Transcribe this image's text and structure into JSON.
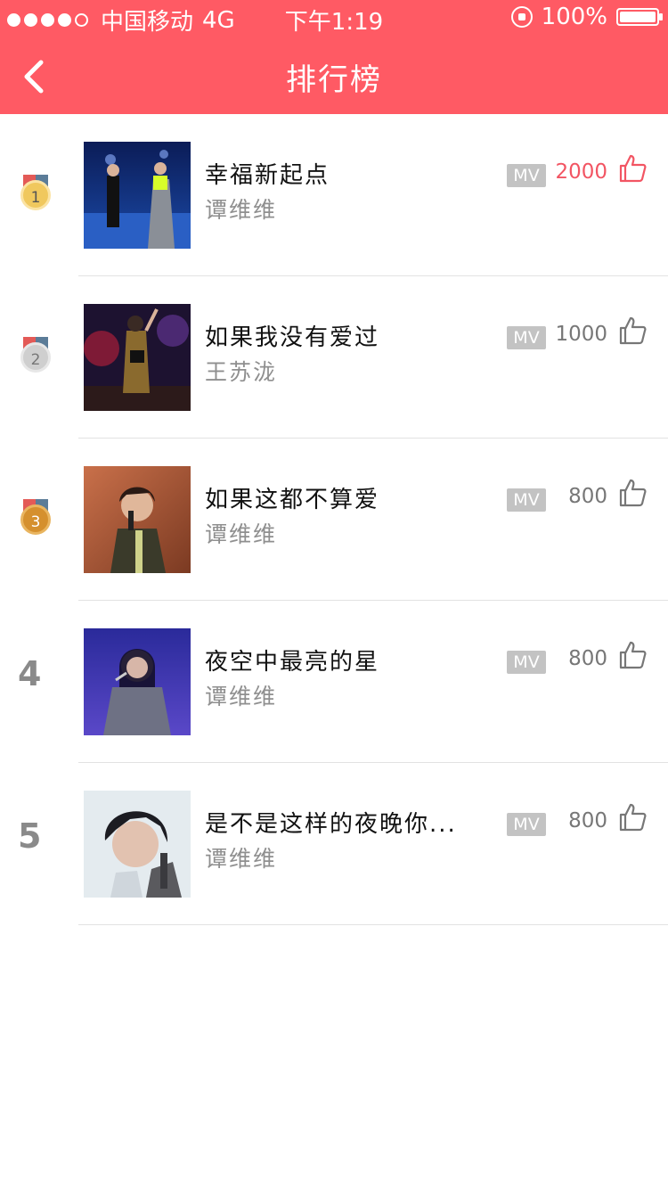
{
  "status_bar": {
    "carrier": "中国移动",
    "network": "4G",
    "time": "下午1:19",
    "battery": "100%",
    "battery_level": 1.0
  },
  "nav": {
    "title": "排行榜"
  },
  "colors": {
    "brand": "#ff5a64",
    "like_active": "#f25563"
  },
  "songs": [
    {
      "rank": "1",
      "title": "幸福新起点",
      "artist": "谭维维",
      "mv": "MV",
      "likes": "2000",
      "liked": true
    },
    {
      "rank": "2",
      "title": "如果我没有爱过",
      "artist": "王苏泷",
      "mv": "MV",
      "likes": "1000",
      "liked": false
    },
    {
      "rank": "3",
      "title": "如果这都不算爱",
      "artist": "谭维维",
      "mv": "MV",
      "likes": "800",
      "liked": false
    },
    {
      "rank": "4",
      "title": "夜空中最亮的星",
      "artist": "谭维维",
      "mv": "MV",
      "likes": "800",
      "liked": false
    },
    {
      "rank": "5",
      "title": "是不是这样的夜晚你...",
      "artist": "谭维维",
      "mv": "MV",
      "likes": "800",
      "liked": false
    }
  ]
}
